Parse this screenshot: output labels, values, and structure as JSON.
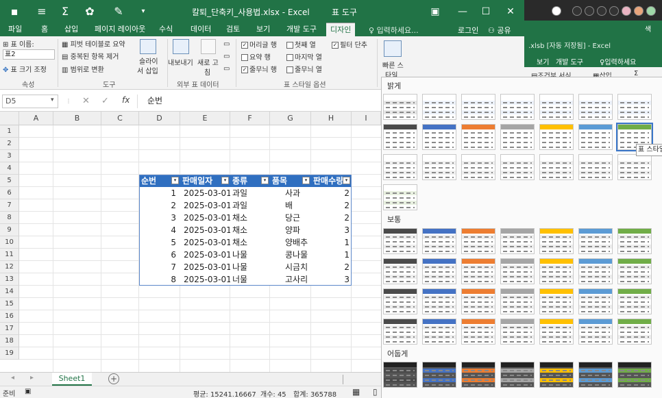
{
  "titlebar": {
    "title": "칼퇴_단축키_사용법.xlsx - Excel",
    "contextual_tab": "표 도구"
  },
  "tabs": [
    "파일",
    "홈",
    "삽입",
    "페이지 레이아웃",
    "수식",
    "데이터",
    "검토",
    "보기",
    "개발 도구",
    "디자인"
  ],
  "tellme_placeholder": "입력하세요...",
  "signin": "로그인",
  "share": "공유",
  "ribbon": {
    "props": {
      "name_label": "표 이름:",
      "name_value": "표2",
      "resize": "표 크기 조정",
      "group": "속성"
    },
    "tools": {
      "pivot": "피벗 테이블로 요약",
      "dedupe": "중복된 항목 제거",
      "convert": "범위로 변환",
      "slicer_1": "슬라이",
      "slicer_2": "서 삽입",
      "group": "도구"
    },
    "external": {
      "export": "내보내기",
      "refresh_1": "새로 고",
      "refresh_2": "침",
      "group": "외부 표 데이터"
    },
    "options": {
      "header_row": "머리글 행",
      "total_row": "요약 행",
      "banded_rows": "줄무늬 행",
      "first_col": "첫째 열",
      "last_col": "마지막 열",
      "banded_cols": "줄무늬 열",
      "filter_btn": "필터 단추",
      "group": "표 스타일 옵션"
    },
    "quick_styles_1": "빠른 스",
    "quick_styles_2": "타일"
  },
  "namebox": "D5",
  "formula": "순번",
  "columns": [
    "A",
    "B",
    "C",
    "D",
    "E",
    "F",
    "G",
    "H",
    "I"
  ],
  "rows": [
    "1",
    "2",
    "3",
    "4",
    "5",
    "6",
    "7",
    "8",
    "9",
    "10",
    "11",
    "12",
    "13",
    "14",
    "15",
    "16",
    "17",
    "18",
    "19"
  ],
  "table": {
    "headers": [
      "순번",
      "판매일자",
      "종류",
      "품목",
      "판매수량"
    ],
    "rows": [
      [
        "1",
        "2025-03-01",
        "과일",
        "사과",
        "2"
      ],
      [
        "2",
        "2025-03-01",
        "과일",
        "배",
        "2"
      ],
      [
        "3",
        "2025-03-01",
        "채소",
        "당근",
        "2"
      ],
      [
        "4",
        "2025-03-01",
        "채소",
        "양파",
        "3"
      ],
      [
        "5",
        "2025-03-01",
        "채소",
        "양배추",
        "1"
      ],
      [
        "6",
        "2025-03-01",
        "나물",
        "콩나물",
        "1"
      ],
      [
        "7",
        "2025-03-01",
        "나물",
        "시금치",
        "2"
      ],
      [
        "8",
        "2025-03-01",
        "너물",
        "고사리",
        "3"
      ]
    ]
  },
  "sheet_tab": "Sheet1",
  "status": {
    "ready": "준비",
    "average": "평균: 15241.16667",
    "count": "개수: 45",
    "sum": "합계: 365788"
  },
  "win2": {
    "title": ".xlsb [자동 저장됨] - Excel",
    "tab_view": "보기",
    "tab_dev": "개발 도구",
    "tellme": "입력하세요",
    "cond_format": "조건부 서식",
    "insert": "삽입",
    "corner": "색"
  },
  "gallery": {
    "light": "밝게",
    "medium": "보통",
    "dark": "어둡게",
    "tooltip": "표 스타일"
  },
  "colors": {
    "excel_green": "#217346",
    "table_header": "#2f6fc0"
  }
}
